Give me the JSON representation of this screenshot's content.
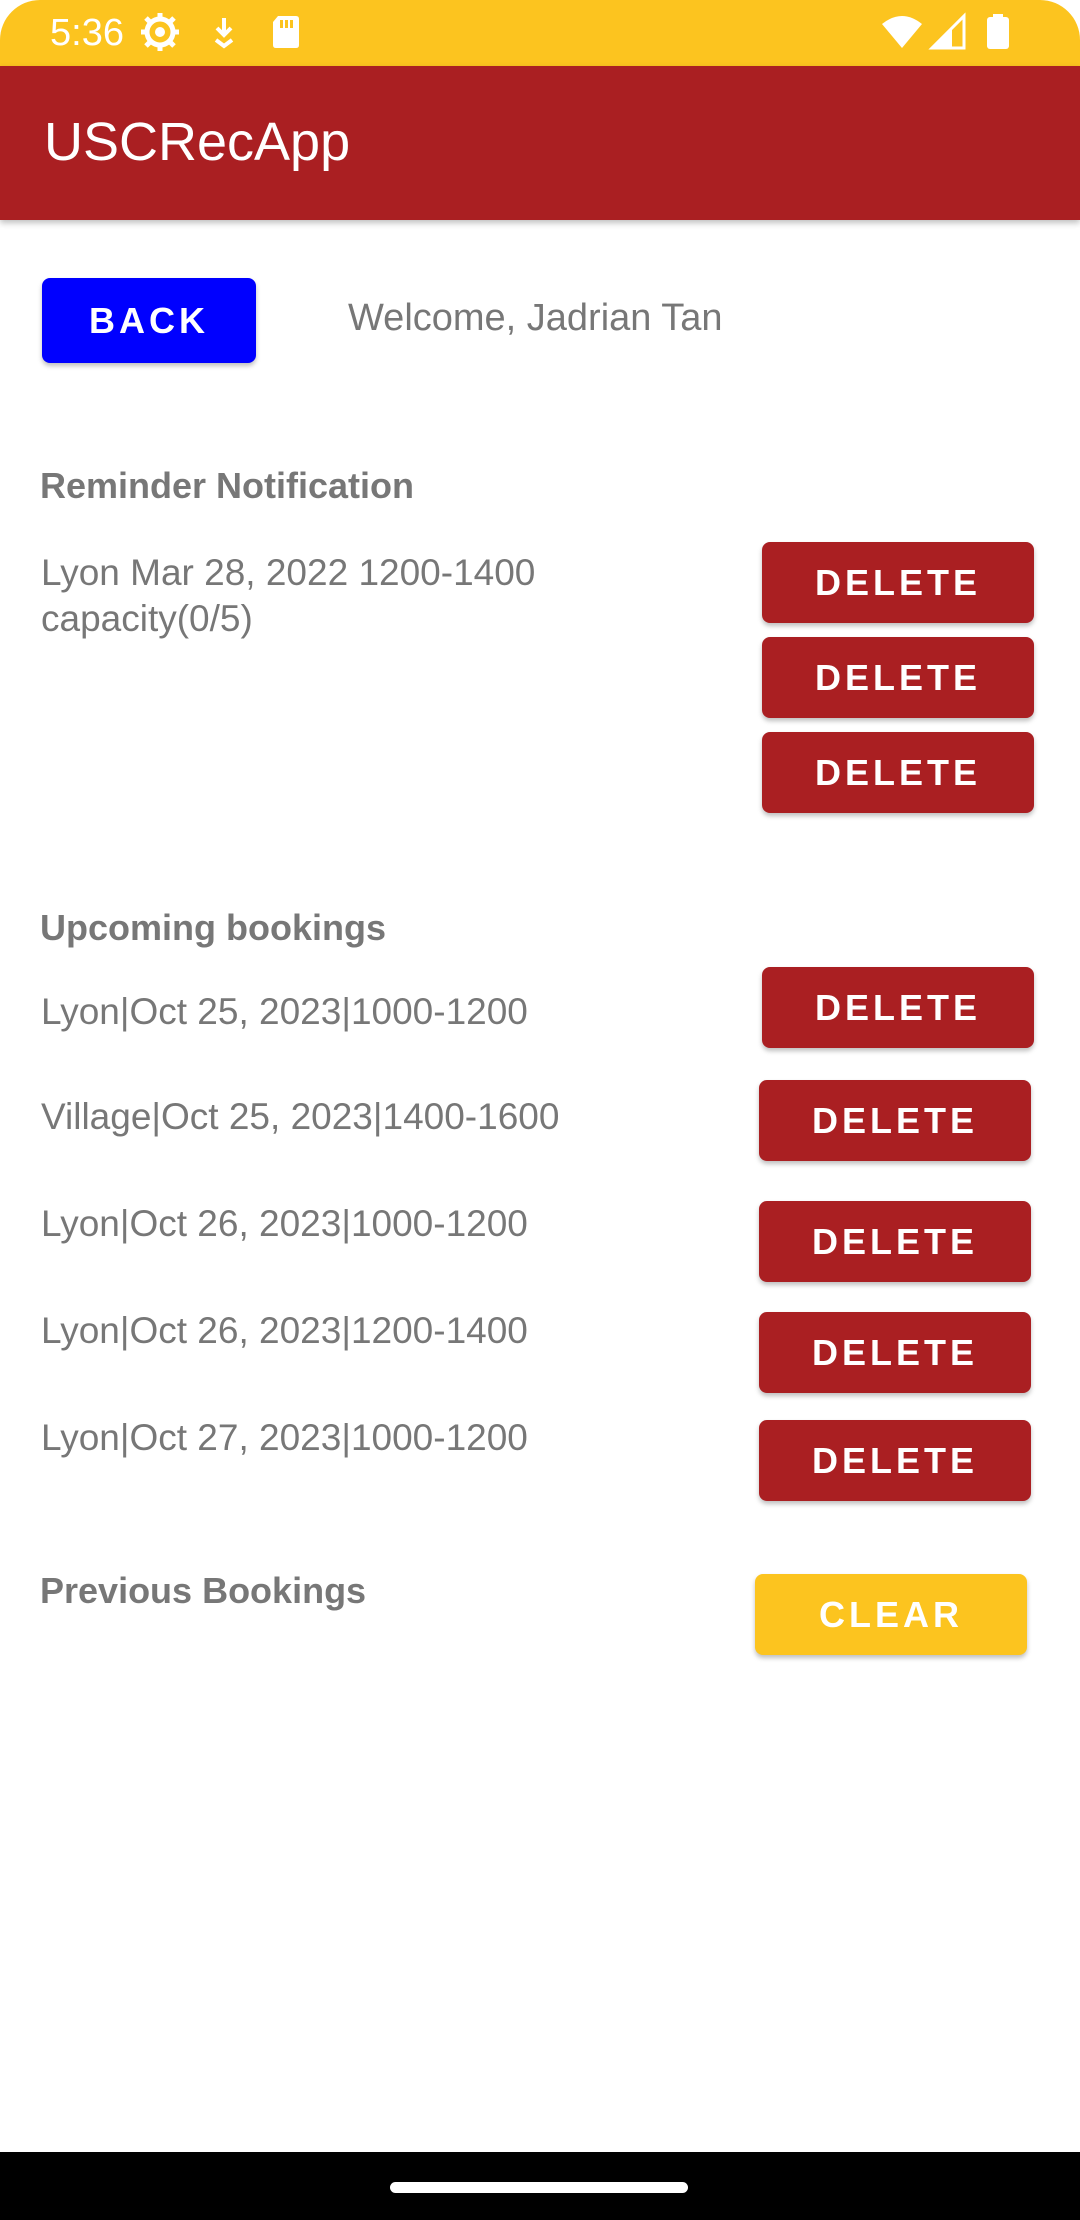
{
  "status_bar": {
    "time": "5:36",
    "left_icons": [
      "gear-icon",
      "download-icon",
      "sd-card-icon"
    ],
    "right_icons": [
      "wifi-icon",
      "signal-icon",
      "battery-icon"
    ]
  },
  "app_bar": {
    "title": "USCRecApp"
  },
  "header": {
    "back_label": "BACK",
    "welcome": "Welcome, Jadrian Tan"
  },
  "reminders": {
    "title": "Reminder Notification",
    "text": "Lyon Mar 28, 2022 1200-1400 capacity(0/5)",
    "delete_labels": [
      "DELETE",
      "DELETE",
      "DELETE"
    ]
  },
  "upcoming": {
    "title": "Upcoming bookings",
    "items": [
      {
        "label": "Lyon|Oct 25, 2023|1000-1200",
        "delete": "DELETE"
      },
      {
        "label": "Village|Oct 25, 2023|1400-1600",
        "delete": "DELETE"
      },
      {
        "label": "Lyon|Oct 26, 2023|1000-1200",
        "delete": "DELETE"
      },
      {
        "label": "Lyon|Oct 26, 2023|1200-1400",
        "delete": "DELETE"
      },
      {
        "label": "Lyon|Oct 27, 2023|1000-1200",
        "delete": "DELETE"
      }
    ]
  },
  "previous": {
    "title": "Previous Bookings",
    "clear_label": "CLEAR"
  },
  "colors": {
    "status_bar": "#FCC41F",
    "app_bar": "#AA1F22",
    "back_button": "#0000FF",
    "delete_button": "#AA1F22",
    "clear_button": "#FCC41F",
    "text_gray": "#777777"
  }
}
